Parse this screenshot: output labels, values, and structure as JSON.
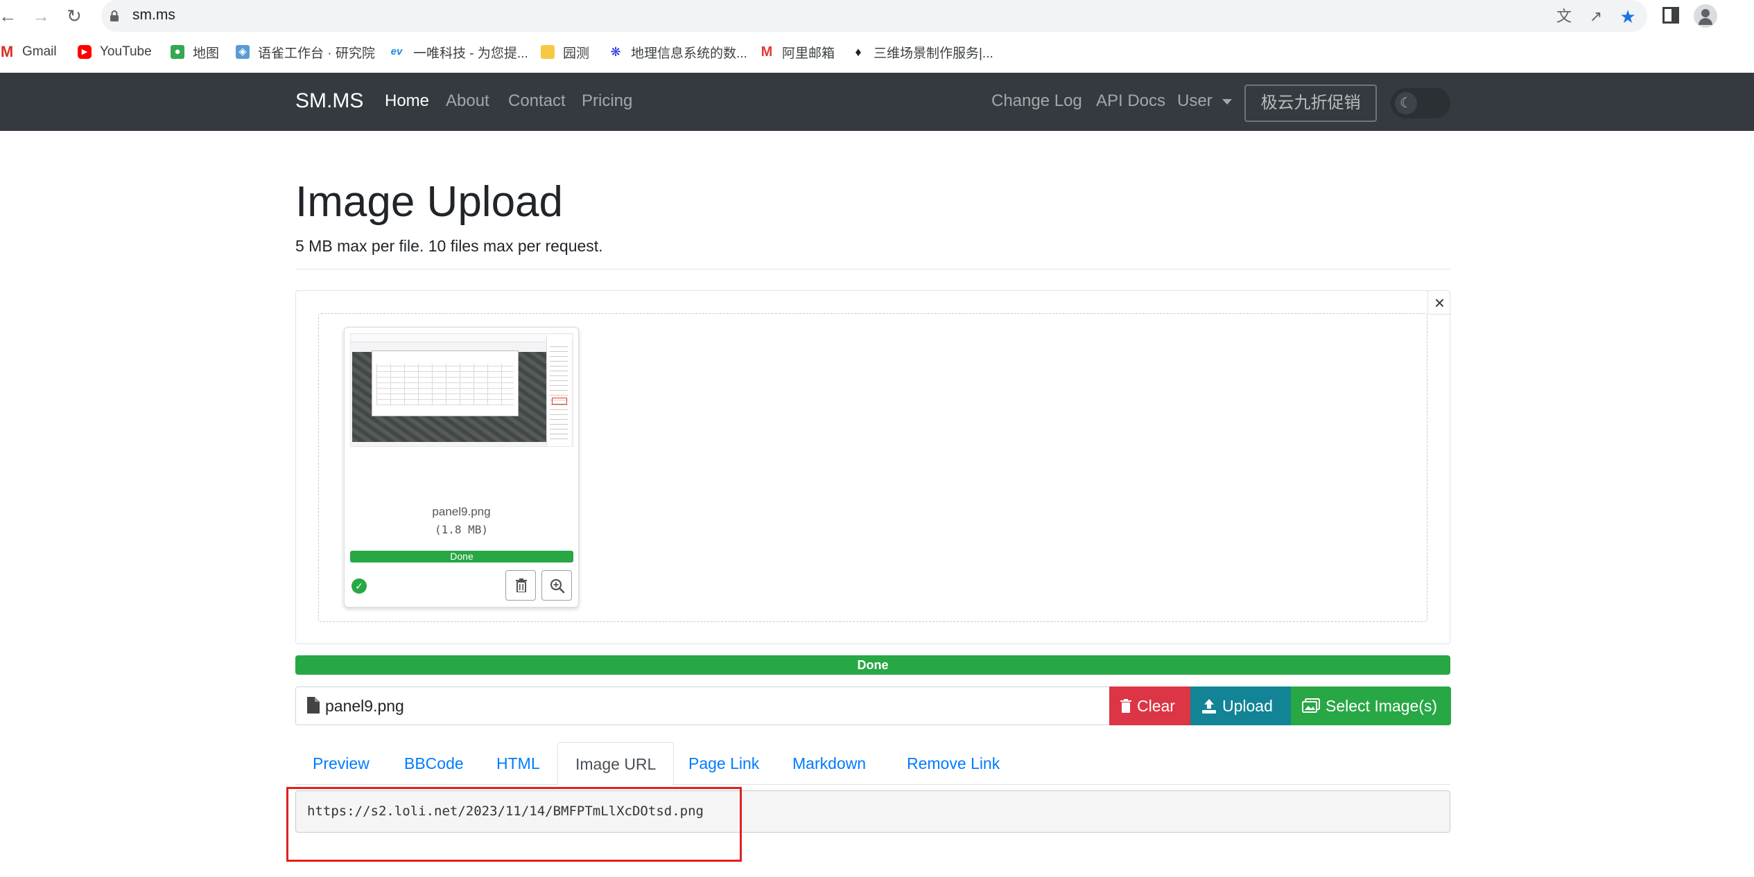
{
  "browser": {
    "url": "sm.ms",
    "bookmarks": [
      {
        "label": "Gmail",
        "icon": "gmail-icon"
      },
      {
        "label": "YouTube",
        "icon": "youtube-icon"
      },
      {
        "label": "地图",
        "icon": "maps-icon"
      },
      {
        "label": "语雀工作台 · 研究院",
        "icon": "yuque-icon"
      },
      {
        "label": "一唯科技 - 为您提...",
        "icon": "ev-icon"
      },
      {
        "label": "园测",
        "icon": "folder-icon"
      },
      {
        "label": "地理信息系统的数...",
        "icon": "baidu-icon"
      },
      {
        "label": "阿里邮箱",
        "icon": "aliyun-mail-icon"
      },
      {
        "label": "三维场景制作服务|...",
        "icon": "3d-icon"
      }
    ]
  },
  "navbar": {
    "brand": "SM.MS",
    "links": [
      "Home",
      "About",
      "Contact",
      "Pricing"
    ],
    "right_links": [
      "Change Log",
      "API Docs"
    ],
    "user_label": "User",
    "promo_label": "极云九折促销"
  },
  "main": {
    "title": "Image Upload",
    "subtitle": "5 MB max per file. 10 files max per request.",
    "thumb": {
      "filename": "panel9.png",
      "size": "(1.8 MB)",
      "status": "Done",
      "progress": 1.0
    },
    "progress_label": "Done",
    "progress": 1.0,
    "selected_file": "panel9.png",
    "buttons": {
      "clear": "Clear",
      "upload": "Upload",
      "select": "Select Image(s)"
    },
    "tabs": [
      "Preview",
      "BBCode",
      "HTML",
      "Image URL",
      "Page Link",
      "Markdown",
      "Remove Link"
    ],
    "active_tab": "Image URL",
    "result_url": "https://s2.loli.net/2023/11/14/BMFPTmLlXcDOtsd.png"
  },
  "colors": {
    "navbar": "#343a40",
    "success": "#28a745",
    "danger": "#dc3545",
    "info": "#138496",
    "link": "#007bff",
    "annotation": "#e02020"
  }
}
